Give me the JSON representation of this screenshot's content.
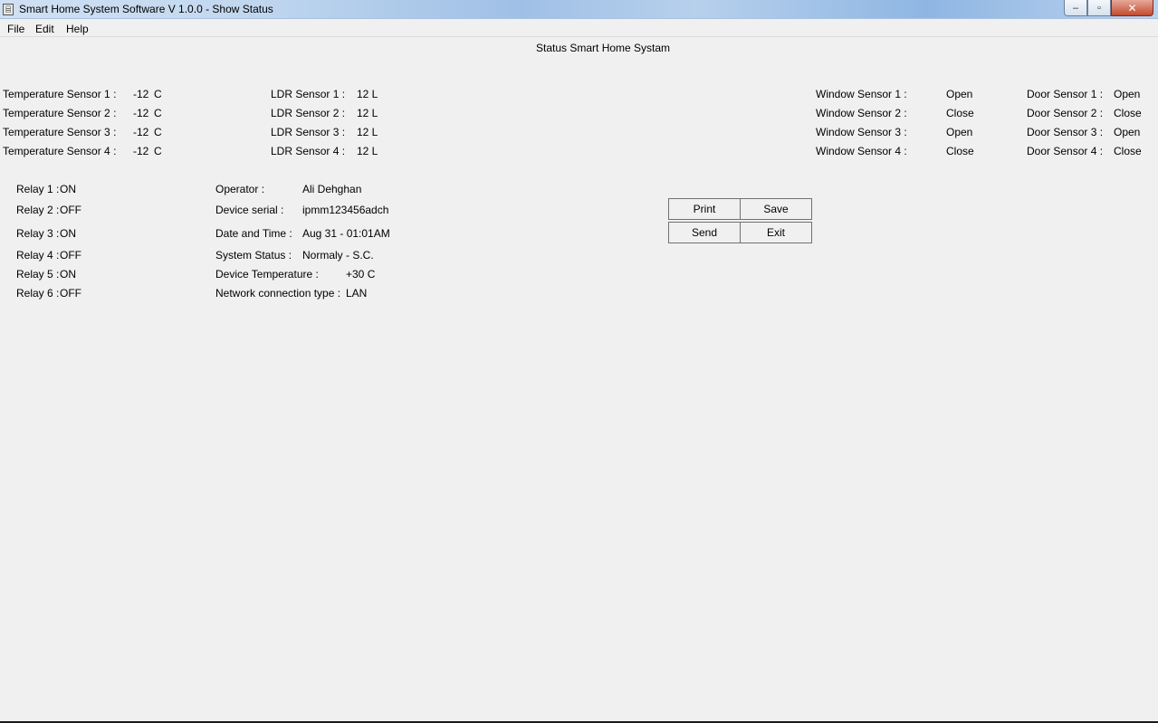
{
  "window": {
    "title": "Smart Home System Software V 1.0.0 - Show Status",
    "icon": "app-icon",
    "controls": {
      "minimize": "–",
      "maximize": "▫",
      "close": "✕"
    }
  },
  "menu": {
    "file": "File",
    "edit": "Edit",
    "help": "Help"
  },
  "page_title": "Status Smart Home Systam",
  "temperature": [
    {
      "label": "Temperature Sensor 1 :",
      "value": "-12",
      "unit": "C"
    },
    {
      "label": "Temperature Sensor 2 :",
      "value": "-12",
      "unit": "C"
    },
    {
      "label": "Temperature Sensor 3 :",
      "value": "-12",
      "unit": "C"
    },
    {
      "label": "Temperature Sensor 4 :",
      "value": "-12",
      "unit": "C"
    }
  ],
  "ldr": [
    {
      "label": "LDR Sensor 1 :",
      "value": "12 L"
    },
    {
      "label": "LDR Sensor 2 :",
      "value": "12 L"
    },
    {
      "label": "LDR Sensor 3 :",
      "value": "12 L"
    },
    {
      "label": "LDR Sensor 4 :",
      "value": "12 L"
    }
  ],
  "window_sensors": [
    {
      "label": "Window Sensor 1 :",
      "value": "Open"
    },
    {
      "label": "Window Sensor 2 :",
      "value": "Close"
    },
    {
      "label": "Window Sensor 3 :",
      "value": "Open"
    },
    {
      "label": "Window Sensor 4 :",
      "value": "Close"
    }
  ],
  "door_sensors": [
    {
      "label": "Door Sensor 1 :",
      "value": "Open"
    },
    {
      "label": "Door Sensor 2 :",
      "value": "Close"
    },
    {
      "label": "Door Sensor 3 :",
      "value": "Open"
    },
    {
      "label": "Door Sensor 4 :",
      "value": "Close"
    }
  ],
  "relays": [
    {
      "label": "Relay 1 :",
      "value": "ON"
    },
    {
      "label": "Relay 2 :",
      "value": "OFF"
    },
    {
      "label": "Relay 3 :",
      "value": "ON"
    },
    {
      "label": "Relay 4 :",
      "value": "OFF"
    },
    {
      "label": "Relay 5 :",
      "value": "ON"
    },
    {
      "label": "Relay 6 :",
      "value": "OFF"
    }
  ],
  "info": {
    "operator_label": "Operator :",
    "operator": "Ali Dehghan",
    "serial_label": "Device serial :",
    "serial": "ipmm123456adch",
    "datetime_label": "Date and Time :",
    "datetime": "Aug 31 - 01:01AM",
    "status_label": "System Status :",
    "status": "Normaly - S.C.",
    "devtemp_label": "Device Temperature :",
    "devtemp": "+30 C",
    "network_label": "Network connection type :",
    "network": "LAN"
  },
  "buttons": {
    "print": "Print",
    "save": "Save",
    "send": "Send",
    "exit": "Exit"
  }
}
